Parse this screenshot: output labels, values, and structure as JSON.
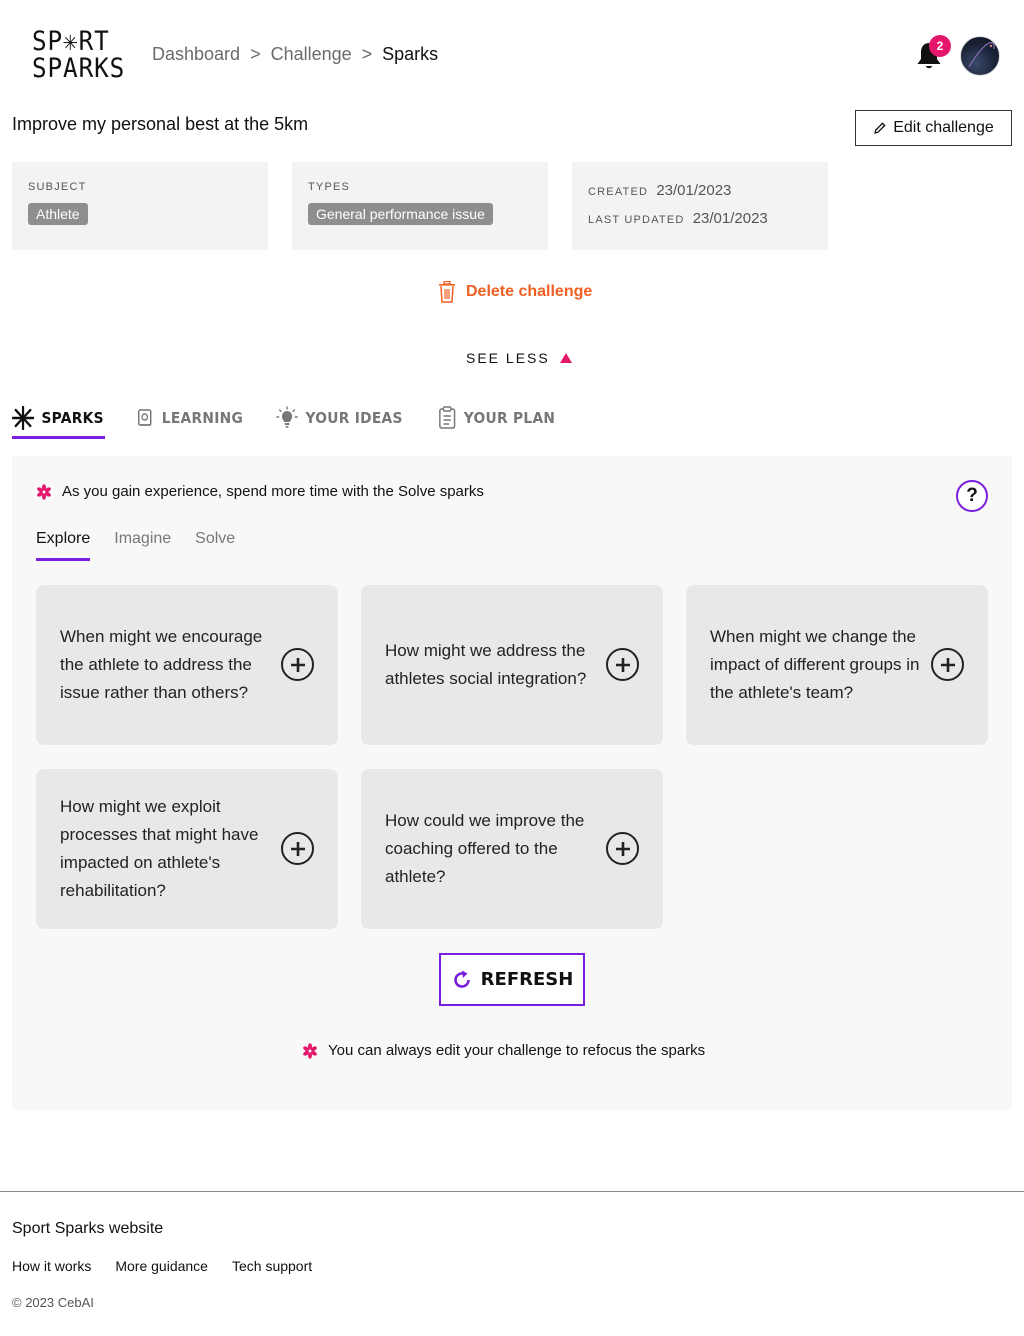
{
  "brand": {
    "logo_line1": "SP✳RT",
    "logo_line2": "SPARKS"
  },
  "breadcrumb": {
    "items": [
      "Dashboard",
      "Challenge"
    ],
    "current": "Sparks",
    "separator": ">"
  },
  "notifications": {
    "count": "2"
  },
  "challenge": {
    "title": "Improve my personal best at the 5km",
    "edit_label": "Edit challenge",
    "subject_label": "SUBJECT",
    "subject_value": "Athlete",
    "types_label": "TYPES",
    "types_value": "General performance issue",
    "created_label": "CREATED",
    "created_value": "23/01/2023",
    "updated_label": "LAST UPDATED",
    "updated_value": "23/01/2023",
    "delete_label": "Delete challenge",
    "see_less_label": "SEE LESS"
  },
  "main_tabs": [
    {
      "label": "SPARKS",
      "icon": "asterisk-icon",
      "active": true
    },
    {
      "label": "LEARNING",
      "icon": "book-icon",
      "active": false
    },
    {
      "label": "YOUR IDEAS",
      "icon": "lightbulb-icon",
      "active": false
    },
    {
      "label": "YOUR PLAN",
      "icon": "clipboard-icon",
      "active": false
    }
  ],
  "panel": {
    "tip_top": "As you gain experience, spend more time with the Solve sparks",
    "help_label": "?",
    "sub_tabs": [
      {
        "label": "Explore",
        "active": true
      },
      {
        "label": "Imagine",
        "active": false
      },
      {
        "label": "Solve",
        "active": false
      }
    ],
    "sparks": [
      "When might we encourage the athlete to address the issue rather than others?",
      "How might we address the athletes social integration?",
      "When might we change the impact of different groups in the athlete's team?",
      "How might we exploit processes that might have impacted on athlete's rehabilitation?",
      "How could we improve the coaching offered to the athlete?"
    ],
    "refresh_label": "REFRESH",
    "tip_bottom": "You can always edit your challenge to refocus the sparks"
  },
  "footer": {
    "title": "Sport Sparks website",
    "links": [
      "How it works",
      "More guidance",
      "Tech support"
    ],
    "copyright": "© 2023 CebAI"
  },
  "colors": {
    "accent_purple": "#7a1fe0",
    "accent_pink": "#e5176b",
    "delete_orange": "#f06022"
  }
}
